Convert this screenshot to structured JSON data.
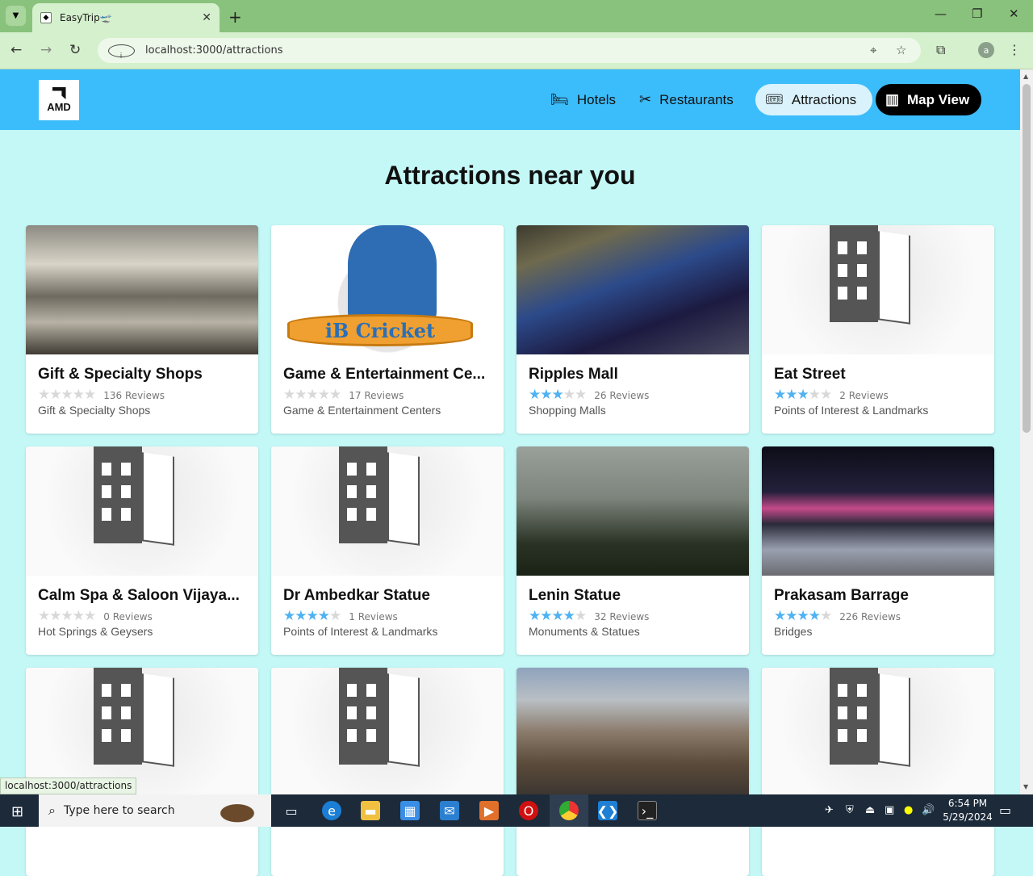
{
  "browser": {
    "tab_title": "EasyTrip🛫",
    "url": "localhost:3000/attractions",
    "profile_initial": "a"
  },
  "nav": {
    "hotels": "Hotels",
    "restaurants": "Restaurants",
    "attractions": "Attractions",
    "map_view": "Map View"
  },
  "logo_text": "AMD",
  "page_heading": "Attractions near you",
  "cards": [
    {
      "title": "Gift & Specialty Shops",
      "rating": 0,
      "reviews": "136 Reviews",
      "category": "Gift & Specialty Shops",
      "image": "mall-interior"
    },
    {
      "title": "Game & Entertainment Ce...",
      "rating": 0,
      "reviews": "17 Reviews",
      "category": "Game & Entertainment Centers",
      "image": "ib-cricket-logo",
      "image_text": "iB Cricket"
    },
    {
      "title": "Ripples Mall",
      "rating": 3,
      "reviews": "26 Reviews",
      "category": "Shopping Malls",
      "image": "bumper-cars"
    },
    {
      "title": "Eat Street",
      "rating": 3,
      "reviews": "2 Reviews",
      "category": "Points of Interest & Landmarks",
      "image": "placeholder-building"
    },
    {
      "title": "Calm Spa & Saloon Vijaya...",
      "rating": 0,
      "reviews": "0 Reviews",
      "category": "Hot Springs & Geysers",
      "image": "placeholder-building"
    },
    {
      "title": "Dr Ambedkar Statue",
      "rating": 4,
      "reviews": "1 Reviews",
      "category": "Points of Interest & Landmarks",
      "image": "placeholder-building"
    },
    {
      "title": "Lenin Statue",
      "rating": 4,
      "reviews": "32 Reviews",
      "category": "Monuments & Statues",
      "image": "statue"
    },
    {
      "title": "Prakasam Barrage",
      "rating": 4,
      "reviews": "226 Reviews",
      "category": "Bridges",
      "image": "barrage-night"
    },
    {
      "image": "placeholder-building"
    },
    {
      "image": "placeholder-building"
    },
    {
      "image": "city-street"
    },
    {
      "image": "placeholder-building"
    }
  ],
  "status_bar": "localhost:3000/attractions",
  "taskbar": {
    "search_placeholder": "Type here to search",
    "time": "6:54 PM",
    "date": "5/29/2024"
  },
  "colors": {
    "header_bg": "#3cbdfb",
    "page_bg": "#c4f8f6",
    "star_on": "#4fb2f2",
    "star_off": "#d8d8d8",
    "map_button_bg": "#000000"
  }
}
